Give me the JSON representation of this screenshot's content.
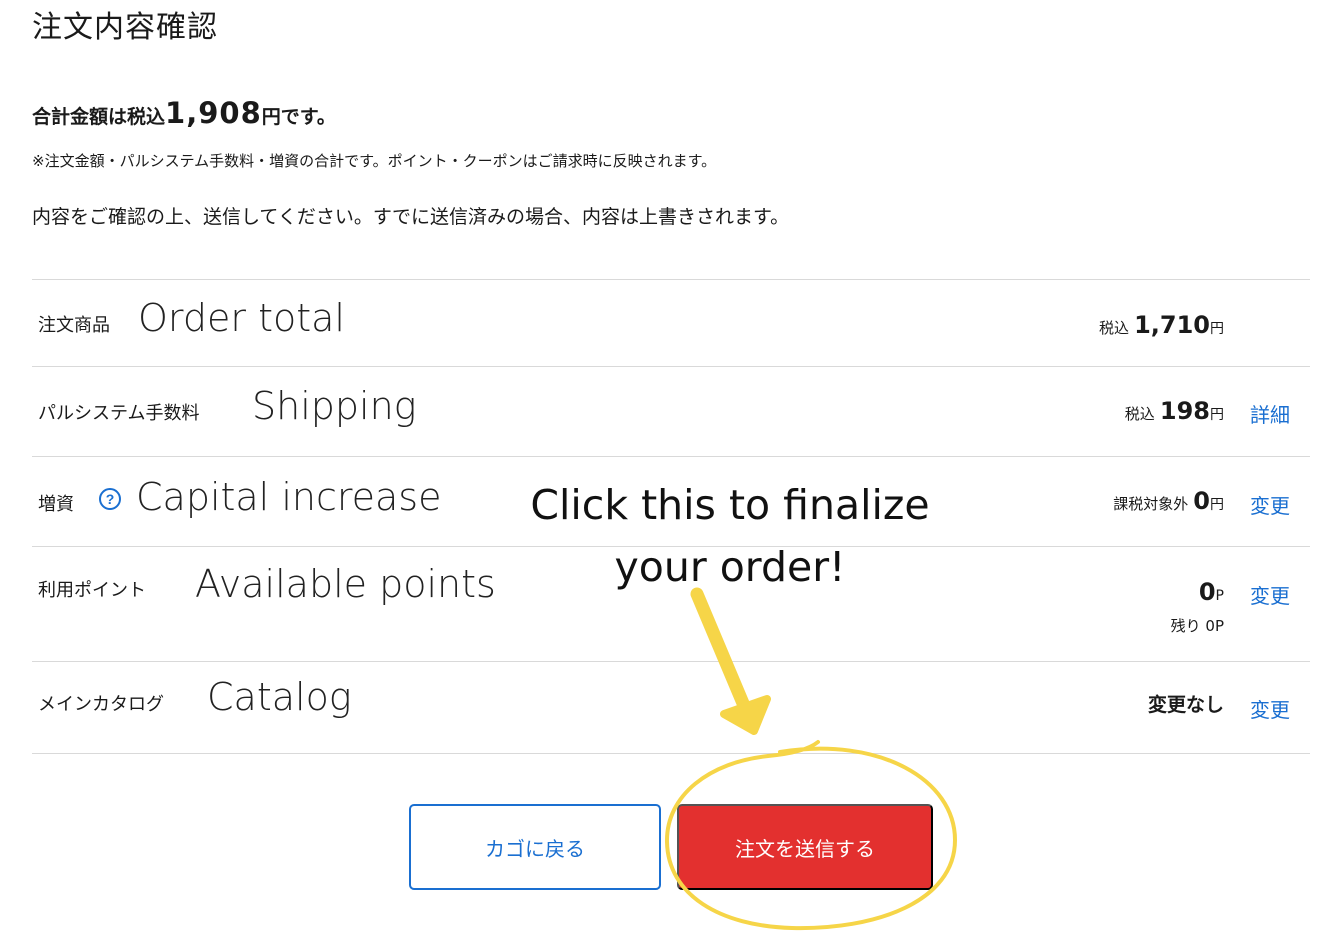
{
  "page": {
    "title": "注文内容確認"
  },
  "summary": {
    "prefix": "合計金額は税込",
    "amount": "1,908",
    "suffix": "円です。",
    "note": "※注文金額・パルシステム手数料・増資の合計です。ポイント・クーポンはご請求時に反映されます。",
    "instruction": "内容をご確認の上、送信してください。すでに送信済みの場合、内容は上書きされます。"
  },
  "rows": {
    "order": {
      "label": "注文商品",
      "label_en": "Order total",
      "value_prefix": "税込",
      "value": "1,710",
      "unit": "円"
    },
    "shipping": {
      "label": "パルシステム手数料",
      "label_en": "Shipping",
      "value_prefix": "税込",
      "value": "198",
      "unit": "円",
      "link": "詳細"
    },
    "capital": {
      "label": "増資",
      "label_en": "Capital increase",
      "value_prefix": "課税対象外",
      "value": "0",
      "unit": "円",
      "link": "変更"
    },
    "points": {
      "label": "利用ポイント",
      "label_en": "Available points",
      "value": "0",
      "unit": "P",
      "remaining": "残り 0P",
      "link": "変更"
    },
    "catalog": {
      "label": "メインカタログ",
      "label_en": "Catalog",
      "value": "変更なし",
      "link": "変更"
    }
  },
  "annotation": {
    "line1": "Click this to finalize",
    "line2": "your order!"
  },
  "buttons": {
    "back": "カゴに戻る",
    "submit": "注文を送信する"
  },
  "colors": {
    "link": "#1a6fd1",
    "submit": "#e3302f",
    "highlight": "#f6d548"
  },
  "icons": {
    "help": "?"
  }
}
